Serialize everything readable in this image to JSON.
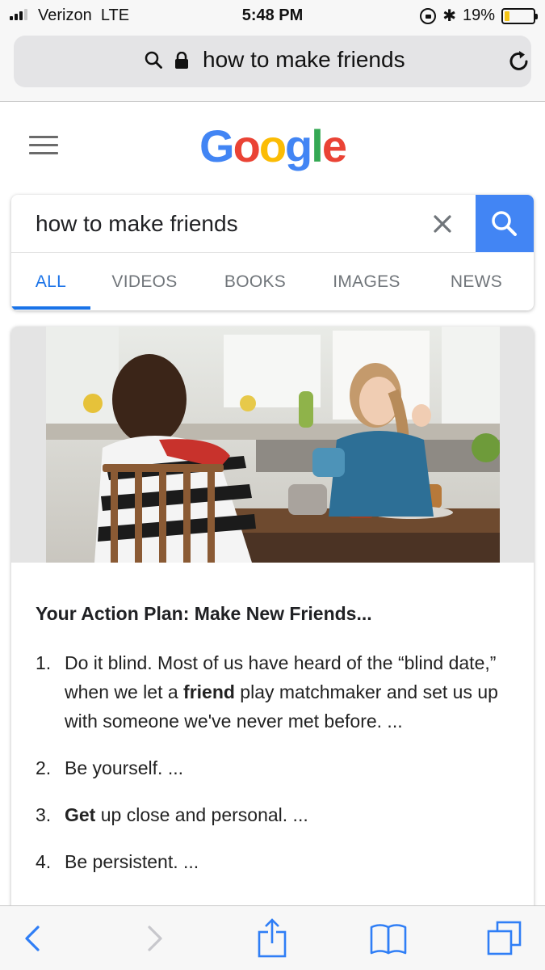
{
  "status_bar": {
    "carrier": "Verizon",
    "network": "LTE",
    "time": "5:48 PM",
    "battery_percent": "19%",
    "battery_level": 0.19,
    "battery_color": "#f5c518"
  },
  "address_bar": {
    "url_text": "how to make friends",
    "icons": [
      "search-icon",
      "lock-icon",
      "reload-icon"
    ]
  },
  "header": {
    "logo_letters": [
      {
        "ch": "G",
        "color": "#4285f4"
      },
      {
        "ch": "o",
        "color": "#ea4335"
      },
      {
        "ch": "o",
        "color": "#fbbc05"
      },
      {
        "ch": "g",
        "color": "#4285f4"
      },
      {
        "ch": "l",
        "color": "#34a853"
      },
      {
        "ch": "e",
        "color": "#ea4335"
      }
    ],
    "menu_icon": "hamburger-icon"
  },
  "search": {
    "query": "how to make friends",
    "accent_color": "#4285f4",
    "tabs": [
      {
        "label": "ALL",
        "active": true
      },
      {
        "label": "VIDEOS",
        "active": false
      },
      {
        "label": "BOOKS",
        "active": false
      },
      {
        "label": "IMAGES",
        "active": false
      },
      {
        "label": "NEWS",
        "active": false
      }
    ]
  },
  "result": {
    "title": "Your Action Plan: Make New Friends...",
    "steps": [
      {
        "num": "1.",
        "parts": [
          {
            "text": "Do it blind. Most of us have heard of the “blind date,” when we let a ",
            "bold": false
          },
          {
            "text": "friend",
            "bold": true
          },
          {
            "text": " play matchmaker and set us up with someone we've never met before. ...",
            "bold": false
          }
        ]
      },
      {
        "num": "2.",
        "parts": [
          {
            "text": "Be yourself. ...",
            "bold": false
          }
        ]
      },
      {
        "num": "3.",
        "parts": [
          {
            "text": "Get",
            "bold": true
          },
          {
            "text": " up close and personal. ...",
            "bold": false
          }
        ]
      },
      {
        "num": "4.",
        "parts": [
          {
            "text": "Be persistent. ...",
            "bold": false
          }
        ]
      }
    ]
  },
  "toolbar": {
    "buttons": [
      "back-icon",
      "forward-icon",
      "share-icon",
      "bookmarks-icon",
      "tabs-icon"
    ],
    "tint_color": "#2f7ef6"
  }
}
